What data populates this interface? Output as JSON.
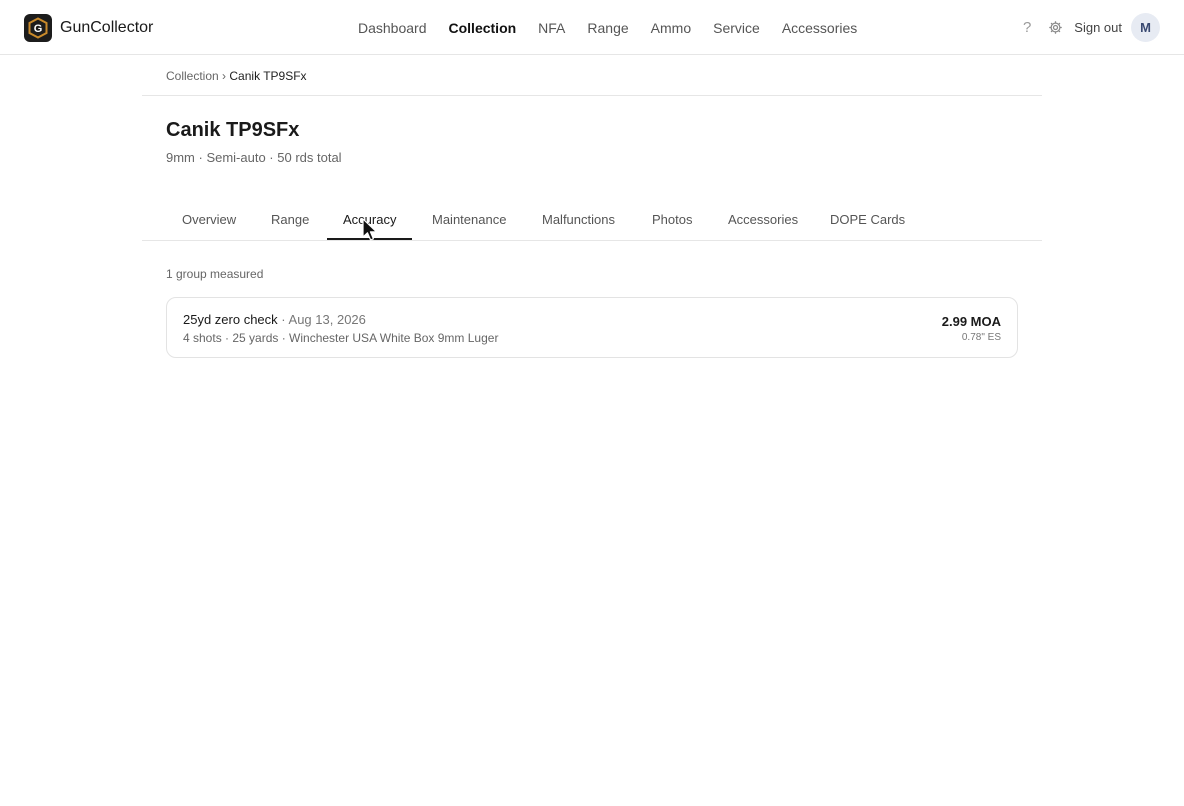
{
  "app": {
    "name": "GunCollector",
    "logo_letter": "G"
  },
  "nav": {
    "items": [
      {
        "label": "Dashboard",
        "active": false
      },
      {
        "label": "Collection",
        "active": true
      },
      {
        "label": "NFA",
        "active": false
      },
      {
        "label": "Range",
        "active": false
      },
      {
        "label": "Ammo",
        "active": false
      },
      {
        "label": "Service",
        "active": false
      },
      {
        "label": "Accessories",
        "active": false
      }
    ]
  },
  "header_tools": {
    "help_label": "?",
    "settings_icon": "gear-icon",
    "sign_out": "Sign out",
    "avatar_initial": "M"
  },
  "breadcrumb": {
    "parent": "Collection",
    "separator": "›",
    "current": "Canik TP9SFx"
  },
  "firearm": {
    "title": "Canik TP9SFx",
    "subtitle": "9mm · Semi-auto · 50 rds total"
  },
  "tabs": [
    {
      "label": "Overview"
    },
    {
      "label": "Range"
    },
    {
      "label": "Accuracy",
      "active": true
    },
    {
      "label": "Maintenance"
    },
    {
      "label": "Malfunctions"
    },
    {
      "label": "Photos"
    },
    {
      "label": "Accessories"
    },
    {
      "label": "DOPE Cards"
    }
  ],
  "accuracy": {
    "count_text": "1 group measured",
    "groups": [
      {
        "name": "25yd zero check",
        "date": "Aug 13, 2026",
        "meta": "4 shots · 25 yards · Winchester USA White Box 9mm Luger",
        "moa": "2.99 MOA",
        "es": "0.78\" ES"
      }
    ]
  },
  "colors": {
    "accent": "#1a1a1a",
    "logo_bg": "#1c1c1c",
    "logo_gold": "#c98a2b",
    "avatar_bg": "#e7ebf3"
  }
}
